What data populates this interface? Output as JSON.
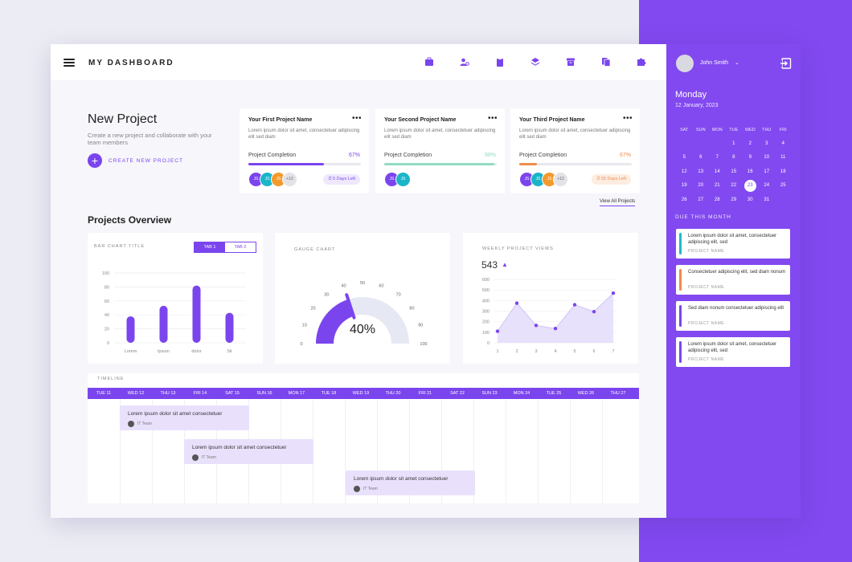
{
  "header": {
    "title": "MY DASHBOARD",
    "icons": [
      "briefcase-icon",
      "users-settings-icon",
      "clipboard-icon",
      "layers-icon",
      "archive-icon",
      "documents-icon",
      "puzzle-icon"
    ]
  },
  "sidebar": {
    "user_name": "John Smith",
    "day": "Monday",
    "date": "12 January, 2023",
    "weekdays": [
      "SAT",
      "SUN",
      "MON",
      "TUE",
      "WED",
      "THU",
      "FRI"
    ],
    "weeks": [
      [
        "",
        "",
        "",
        "1",
        "2",
        "3",
        "4"
      ],
      [
        "5",
        "6",
        "7",
        "8",
        "9",
        "10",
        "11"
      ],
      [
        "12",
        "13",
        "14",
        "15",
        "16",
        "17",
        "18"
      ],
      [
        "19",
        "20",
        "21",
        "22",
        "23",
        "24",
        "25"
      ],
      [
        "26",
        "27",
        "28",
        "29",
        "30",
        "31",
        ""
      ]
    ],
    "selected_day": "23",
    "due_title": "DUE THIS MONTH",
    "due_items": [
      {
        "text": "Lorem ipsum dolor sit amet, consectetuer adipiscing elit, sed",
        "project": "PROJECT NAME",
        "color": "#22b8c7"
      },
      {
        "text": "Consectetuer adipiscing elit, sed diam nonum",
        "project": "PROJECT NAME",
        "color": "#f08c4b"
      },
      {
        "text": "Sed diam nonum consectetuer adipiscing elit",
        "project": "PROJECT NAME",
        "color": "#7b45ee"
      },
      {
        "text": "Lorem ipsum dolor sit amet, consectetuer adipiscing elit, sed",
        "project": "PROJECT NAME",
        "color": "#7b45ee"
      }
    ]
  },
  "new_project": {
    "title": "New Project",
    "subtitle": "Create a new project and collaborate with your team members",
    "create_label": "CREATE NEW PROJECT"
  },
  "projects": [
    {
      "title": "Your First Project Name",
      "desc": "Lorem ipsum dolor sit amet, consectetuer adipiscing elit sed diam",
      "completion_label": "Project Completion",
      "completion": "67%",
      "progress": 0.67,
      "color": "#7b45ee",
      "members": [
        {
          "initials": "JS",
          "color": "#7b45ee"
        },
        {
          "initials": "JS",
          "color": "#1ab5c9"
        },
        {
          "initials": "JS",
          "color": "#f39a2d"
        }
      ],
      "extra": "+12",
      "days_left": "5 Days Left",
      "days_bg": "#efe8fd",
      "days_color": "#7b45ee"
    },
    {
      "title": "Your Second Project Name",
      "desc": "Lorem ipsum dolor sit amet, consectetuer adipiscing elit sed diam",
      "completion_label": "Project Completion",
      "completion": "98%",
      "progress": 0.98,
      "color": "#93dcc2",
      "members": [
        {
          "initials": "JS",
          "color": "#7b45ee"
        },
        {
          "initials": "JS",
          "color": "#1ab5c9"
        }
      ],
      "extra": "",
      "days_left": "",
      "days_bg": "",
      "days_color": ""
    },
    {
      "title": "Your Third Project Name",
      "desc": "Lorem ipsum dolor sit amet, consectetuer adipiscing elit sed diam",
      "completion_label": "Project Completion",
      "completion": "67%",
      "progress": 0.16,
      "color": "#f08c4b",
      "members": [
        {
          "initials": "JS",
          "color": "#7b45ee"
        },
        {
          "initials": "JS",
          "color": "#1ab5c9"
        },
        {
          "initials": "JS",
          "color": "#f39a2d"
        }
      ],
      "extra": "+12",
      "days_left": "55 Days Left",
      "days_bg": "#fdece1",
      "days_color": "#f08c4b"
    }
  ],
  "view_all": "View All Projects",
  "overview_title": "Projects Overview",
  "bar_widget": {
    "title": "BAR CHART TITLE",
    "tabs": [
      "TAB 1",
      "TAB 2"
    ]
  },
  "gauge_widget": {
    "title": "GAUGE CHART",
    "value_label": "40%"
  },
  "views_widget": {
    "title": "WEEKLY PROJECT VIEWS",
    "count": "543",
    "trend": "▲"
  },
  "chart_data": [
    {
      "type": "bar",
      "categories": [
        "Lorem",
        "Ipsum",
        "dolor",
        "Sit"
      ],
      "values": [
        38,
        53,
        82,
        43
      ],
      "ylim": [
        0,
        100
      ],
      "yticks": [
        0,
        20,
        40,
        60,
        80,
        100
      ],
      "color": "#7b45ee",
      "grid": true
    },
    {
      "type": "gauge",
      "value": 40,
      "range": [
        0,
        100
      ],
      "ticks": [
        0,
        10,
        20,
        30,
        40,
        50,
        60,
        70,
        80,
        90,
        100
      ],
      "color": "#7b45ee",
      "track_color": "#e6e9f3"
    },
    {
      "type": "area",
      "x": [
        1,
        2,
        3,
        4,
        5,
        6,
        7
      ],
      "values": [
        110,
        375,
        165,
        135,
        360,
        295,
        470
      ],
      "ylim": [
        0,
        600
      ],
      "yticks": [
        0,
        100,
        200,
        300,
        400,
        500,
        600
      ],
      "color": "#7b45ee",
      "fill": "#e8e1fb",
      "grid": true
    }
  ],
  "timeline": {
    "title": "TIMELINE",
    "days": [
      "TUE 11",
      "WED 12",
      "THU 13",
      "FRI 14",
      "SAT 15",
      "SUN 16",
      "MON 17",
      "TUE 18",
      "WED 19",
      "THU 20",
      "FRI 21",
      "SAT 22",
      "SUN 23",
      "MON 24",
      "TUE 25",
      "WED 26",
      "THU 27"
    ],
    "tasks": [
      {
        "text": "Lorem ipsum dolor sit amet consectetuer",
        "team": "IT Team"
      },
      {
        "text": "Lorem ipsum dolor sit amet consectetuer",
        "team": "IT Team"
      },
      {
        "text": "Lorem ipsum dolor sit amet consectetuer",
        "team": "IT Team"
      }
    ]
  }
}
